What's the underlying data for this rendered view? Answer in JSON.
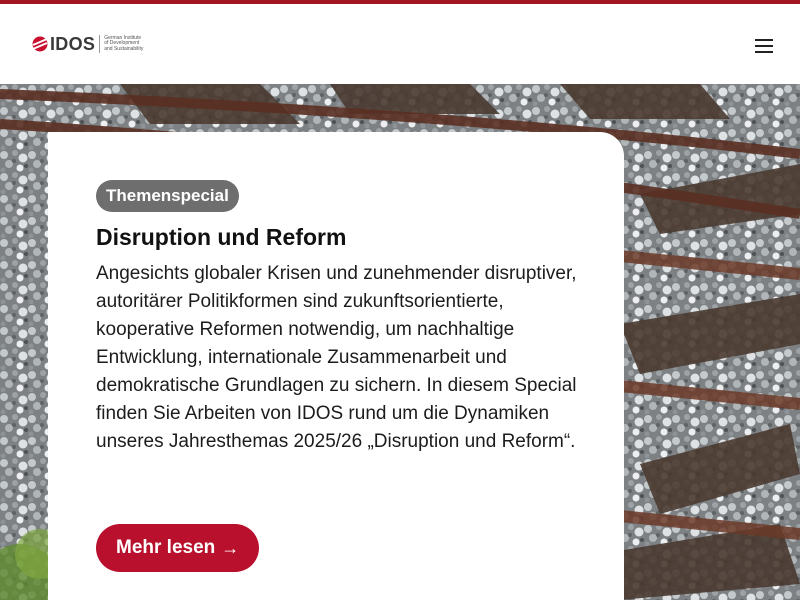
{
  "header": {
    "logo_text": "IDOS",
    "tagline_lines": [
      "German Institute",
      "of Development",
      "and Sustainability"
    ],
    "menu_icon": "hamburger-menu-icon"
  },
  "hero": {
    "image_subject": "railway tracks with gravel ballast"
  },
  "card": {
    "badge": "Themenspecial",
    "title": "Disruption und Reform",
    "description": "Angesichts globaler Krisen und zunehmender disruptiver, autoritärer Politikformen sind zukunftsorientierte, kooperative Reformen notwendig, um nachhaltige Entwicklung, internationale Zusammenarbeit und demokratische Grundlagen zu sichern. In diesem Special finden Sie Arbeiten von IDOS rund um die Dynamiken unseres Jahresthemas 2025/26 „Disruption und Reform“.",
    "cta_label": "Mehr lesen",
    "cta_icon": "arrow-right-icon"
  },
  "colors": {
    "brand_red": "#a31523",
    "cta_red": "#b8102d",
    "badge_gray": "#6e6e6e"
  }
}
